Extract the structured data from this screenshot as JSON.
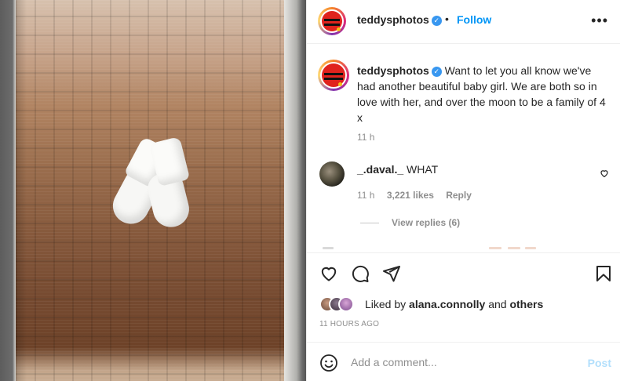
{
  "post": {
    "username": "teddysphotos",
    "separator": "•",
    "follow_label": "Follow",
    "more_label": "•••",
    "caption_text": "Want to let you all know we've had another beautiful baby girl. We are both so in love with her, and over the moon to be a family of 4 x",
    "caption_time": "11 h"
  },
  "comment": {
    "username": "_.daval._",
    "text": "WHAT",
    "time": "11 h",
    "likes": "3,221 likes",
    "reply_label": "Reply",
    "view_replies": "View replies (6)"
  },
  "likes": {
    "prefix": "Liked by",
    "user": "alana.connolly",
    "conjunction": "and",
    "others": "others",
    "timestamp": "11 HOURS AGO"
  },
  "comment_box": {
    "placeholder": "Add a comment...",
    "post_label": "Post"
  },
  "colors": {
    "accent": "#0095f6",
    "post_disabled": "#b2dffc",
    "verified": "#3897f0"
  },
  "icons": [
    "verified-icon",
    "more-icon",
    "heart-icon",
    "comment-icon",
    "share-icon",
    "bookmark-icon",
    "emoji-icon"
  ]
}
